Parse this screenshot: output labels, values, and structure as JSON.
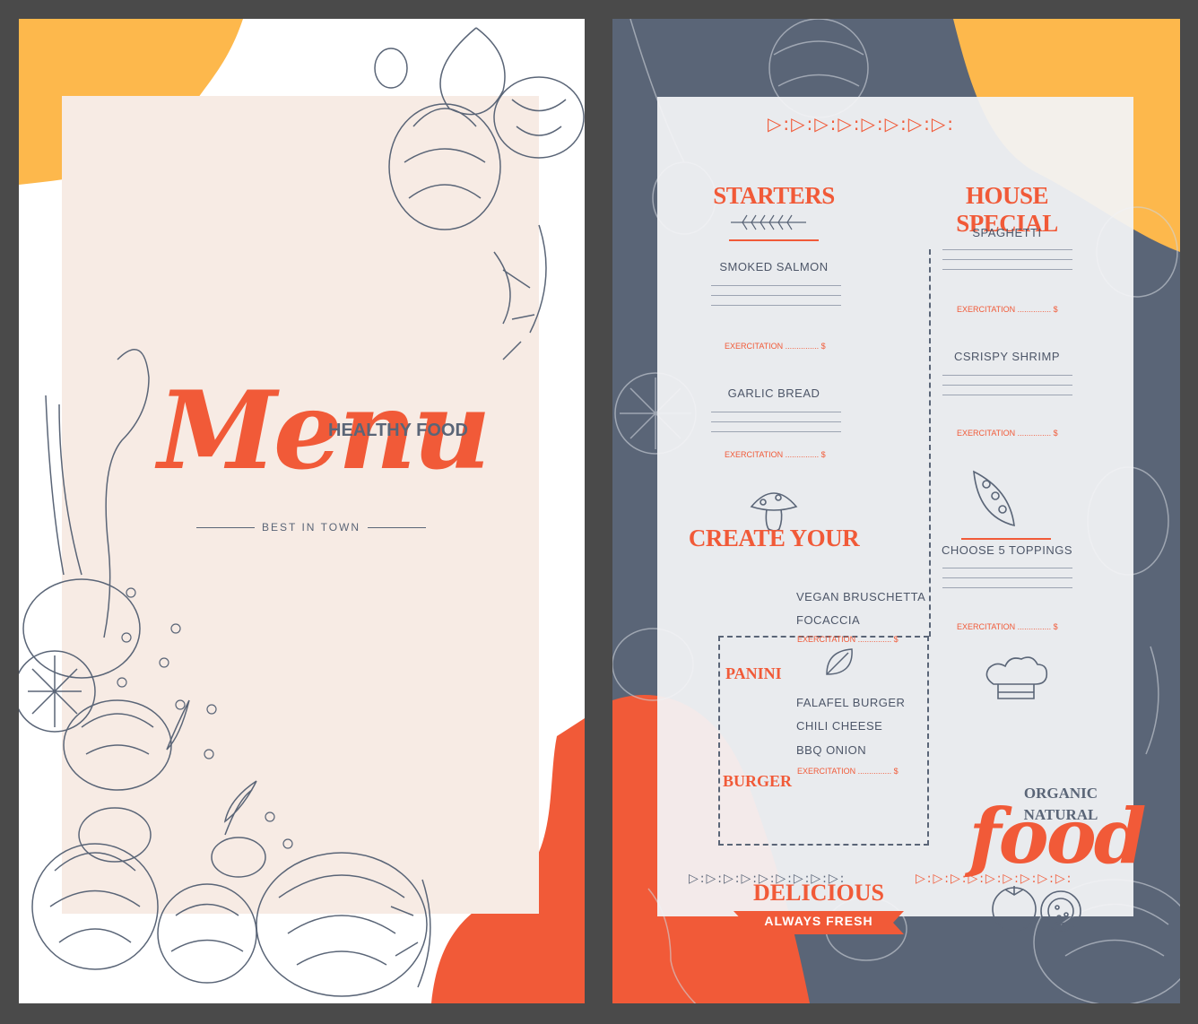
{
  "left_menu": {
    "script_title": "Menu",
    "heading": "HEALTHY FOOD",
    "tagline": "BEST IN TOWN"
  },
  "right_menu": {
    "starters": {
      "title": "STARTERS",
      "items": [
        {
          "name": "SMOKED SALMON",
          "price": "EXERCITATION ............... $"
        },
        {
          "name": "GARLIC BREAD",
          "price": "EXERCITATION ............... $"
        }
      ]
    },
    "house_special": {
      "title": "HOUSE SPECIAL",
      "items": [
        {
          "name": "SPAGHETTI",
          "price": "EXERCITATION ............... $"
        },
        {
          "name": "CSRISPY SHRIMP",
          "price": "EXERCITATION ............... $"
        },
        {
          "name": "CHOOSE 5 TOPPINGS",
          "price": "EXERCITATION ............... $"
        }
      ]
    },
    "create_your": {
      "title": "CREATE YOUR",
      "panini": {
        "label": "PANINI",
        "options": [
          "VEGAN BRUSCHETTA",
          "FOCACCIA"
        ],
        "price": "EXERCITATION ............... $"
      },
      "burger": {
        "label": "BURGER",
        "options": [
          "FALAFEL BURGER",
          "CHILI CHEESE",
          "BBQ ONION"
        ],
        "price": "EXERCITATION ............... $"
      }
    },
    "delicious": {
      "title": "DELICIOUS",
      "ribbon": "ALWAYS FRESH"
    },
    "organic": {
      "line1": "ORGANIC",
      "line2": "NATURAL",
      "script": "food"
    },
    "triangle_row": "▷:▷:▷:▷:▷:▷:▷:▷:",
    "triangle_row_small": "▷:▷:▷:▷:▷:▷:▷:▷:▷:"
  },
  "colors": {
    "accent": "#f15a38",
    "slate": "#5a6577",
    "yellow": "#fdb84c",
    "beige": "#f7ebe4",
    "frame": "#4a4a4a"
  }
}
